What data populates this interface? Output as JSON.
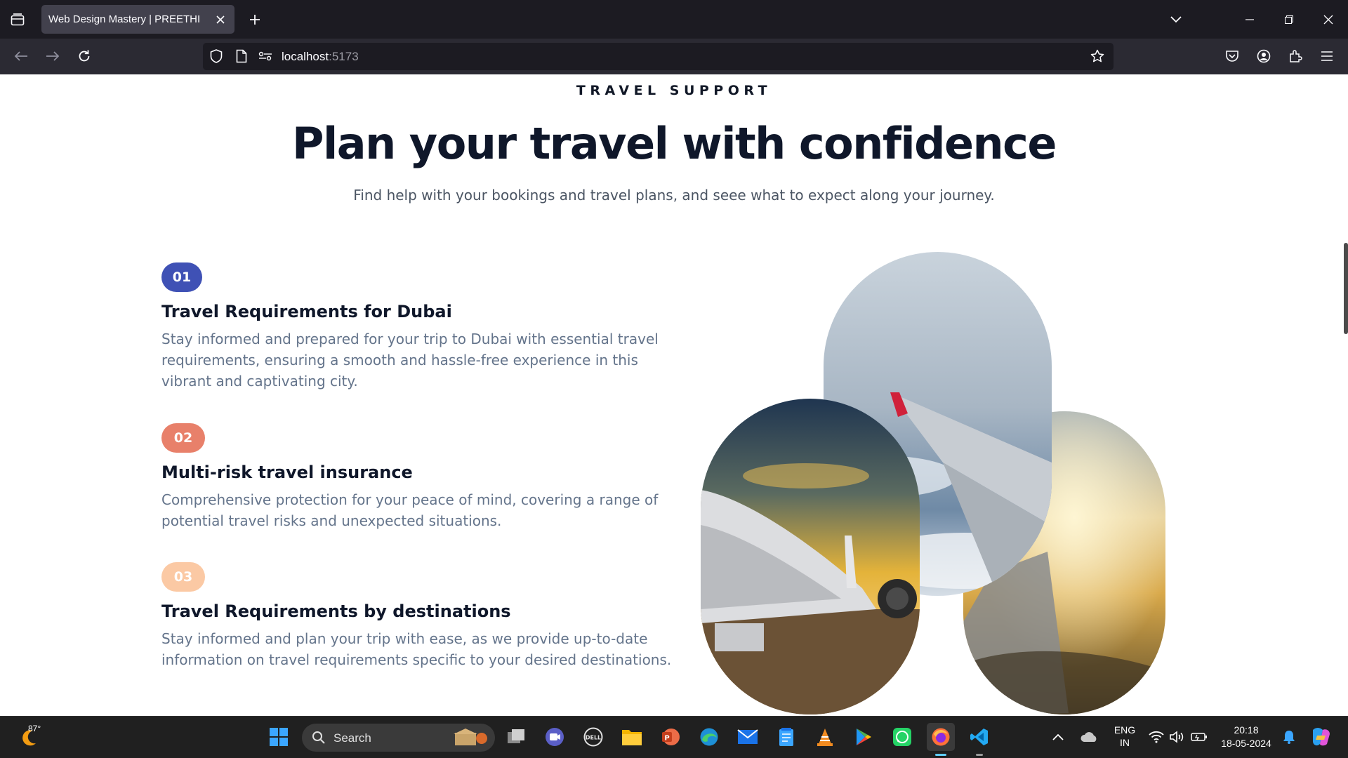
{
  "browser": {
    "tab_title": "Web Design Mastery | PREETHI",
    "url_host": "localhost",
    "url_port": ":5173"
  },
  "page": {
    "eyebrow": "TRAVEL SUPPORT",
    "headline": "Plan your travel with confidence",
    "subline": "Find help with your bookings and travel plans, and seee what to expect along your journey.",
    "features": [
      {
        "number": "01",
        "color": "#3f51b5",
        "title": "Travel Requirements for Dubai",
        "description": "Stay informed and prepared for your trip to Dubai with essential travel requirements, ensuring a smooth and hassle-free experience in this vibrant and captivating city."
      },
      {
        "number": "02",
        "color": "#e8806a",
        "title": "Multi-risk travel insurance",
        "description": "Comprehensive protection for your peace of mind, covering a range of potential travel risks and unexpected situations."
      },
      {
        "number": "03",
        "color": "#fbc9a4",
        "title": "Travel Requirements by destinations",
        "description": "Stay informed and plan your trip with ease, as we provide up-to-date information on travel requirements specific to your desired destinations."
      }
    ],
    "images": [
      "airplane-wing-sky-photo",
      "airplane-on-runway-sunset-photo",
      "wing-over-clouds-sunset-photo"
    ]
  },
  "taskbar": {
    "weather_temp": "87°",
    "search_placeholder": "Search",
    "language": "ENG",
    "region": "IN",
    "time": "20:18",
    "date": "18-05-2024",
    "apps": [
      "windows-start",
      "search",
      "task-view",
      "meet",
      "dell",
      "file-explorer",
      "powerpoint",
      "edge",
      "mail",
      "notepad",
      "vlc",
      "play-store",
      "whatsapp",
      "firefox",
      "vscode"
    ]
  }
}
